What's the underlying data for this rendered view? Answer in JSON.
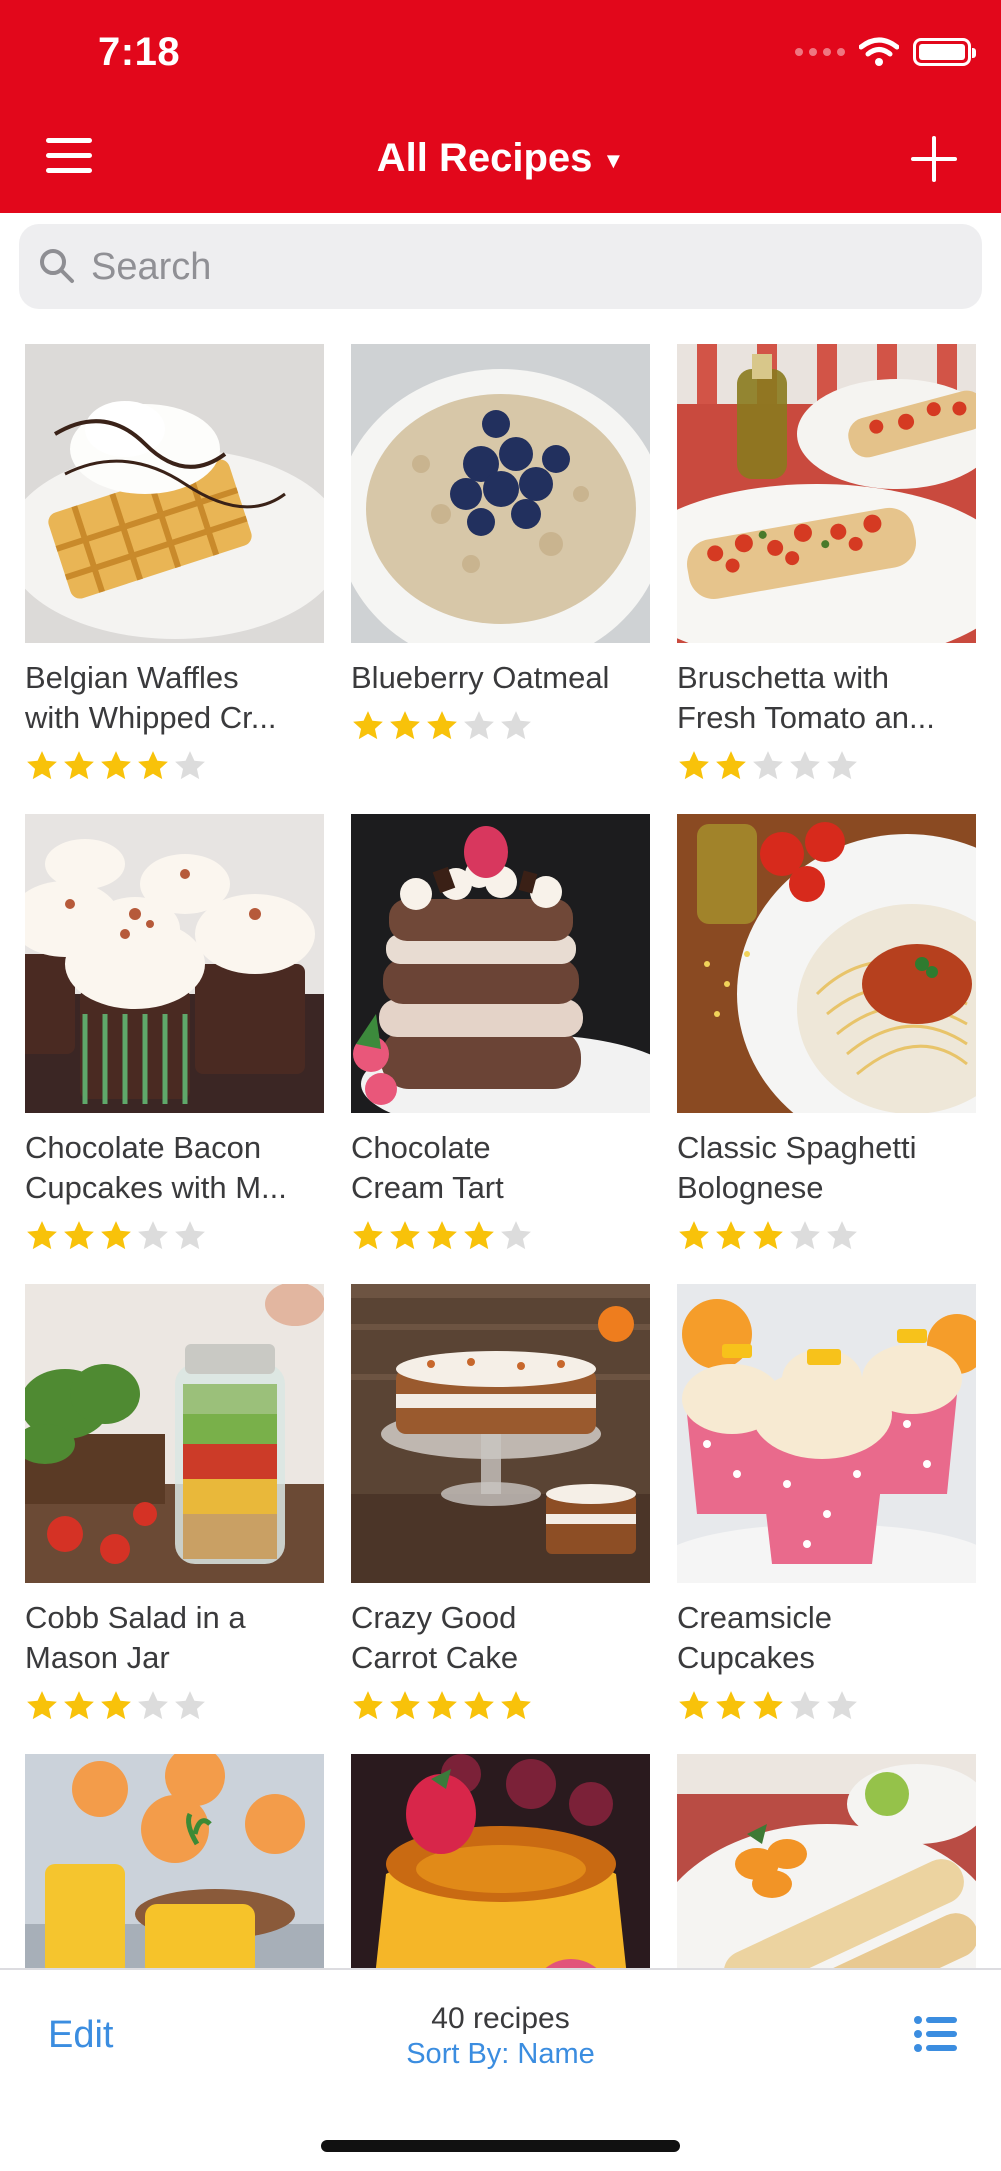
{
  "status_bar": {
    "time": "7:18"
  },
  "nav": {
    "title": "All Recipes"
  },
  "search": {
    "placeholder": "Search"
  },
  "colors": {
    "brand": "#e2071b",
    "accent": "#3b8de0",
    "star_on": "#f8c20a",
    "star_off": "#dcdcdc"
  },
  "recipes": [
    {
      "line1": "Belgian Waffles",
      "line2": "with Whipped Cr...",
      "rating": 4
    },
    {
      "line1": "Blueberry Oatmeal",
      "line2": "",
      "rating": 3
    },
    {
      "line1": "Bruschetta with",
      "line2": "Fresh Tomato an...",
      "rating": 2
    },
    {
      "line1": "Chocolate Bacon",
      "line2": "Cupcakes with M...",
      "rating": 3
    },
    {
      "line1": "Chocolate",
      "line2": "Cream Tart",
      "rating": 4
    },
    {
      "line1": "Classic Spaghetti",
      "line2": "Bolognese",
      "rating": 3
    },
    {
      "line1": "Cobb Salad in a",
      "line2": "Mason Jar",
      "rating": 3
    },
    {
      "line1": "Crazy Good",
      "line2": "Carrot Cake",
      "rating": 5
    },
    {
      "line1": "Creamsicle",
      "line2": "Cupcakes",
      "rating": 3
    },
    {
      "line1": "",
      "line2": "",
      "rating": 0
    },
    {
      "line1": "",
      "line2": "",
      "rating": 0
    },
    {
      "line1": "",
      "line2": "",
      "rating": 0
    }
  ],
  "footer": {
    "edit": "Edit",
    "count": "40 recipes",
    "sort": "Sort By: Name"
  }
}
